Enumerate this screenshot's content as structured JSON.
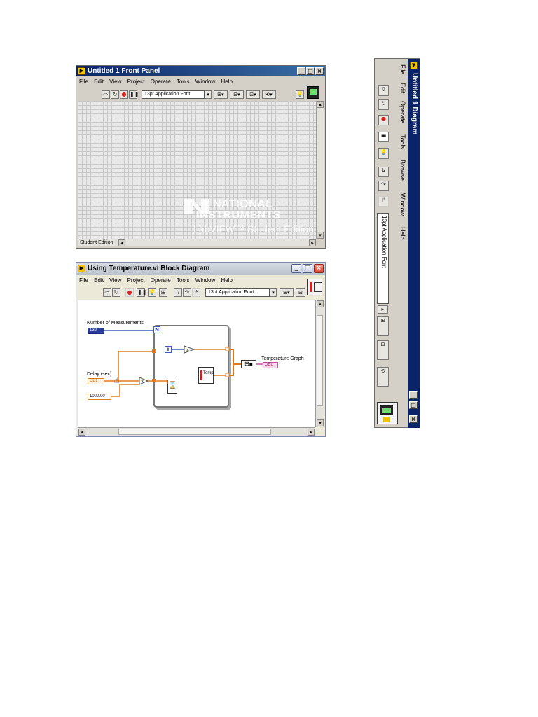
{
  "front_panel": {
    "title": "Untitled 1 Front Panel",
    "menu": [
      "File",
      "Edit",
      "View",
      "Project",
      "Operate",
      "Tools",
      "Window",
      "Help"
    ],
    "font_selector": "13pt Application Font",
    "watermark": {
      "line1": "NATIONAL",
      "line2": "INSTRUMENTS",
      "line3": "LabVIEW™ Student Edition"
    },
    "status_text": "Student Edition",
    "window_buttons": [
      "_",
      "□",
      "×"
    ]
  },
  "block_diagram": {
    "title": "Using Temperature.vi Block Diagram",
    "menu": [
      "File",
      "Edit",
      "View",
      "Project",
      "Operate",
      "Tools",
      "Window",
      "Help"
    ],
    "font_selector": "13pt Application Font",
    "labels": {
      "num_measurements": "Number of Measurements",
      "num_measurements_value": "132",
      "loop_count": "N",
      "iteration": "i",
      "delay": "Delay (sec)",
      "delay_value": "DBL",
      "constant": "1000.00",
      "temp_subvi": "Temp",
      "graph": "Temperature Graph",
      "graph_terminal": "DBL",
      "multiply": "×"
    },
    "window_buttons": [
      "_",
      "□",
      "×"
    ]
  },
  "vertical_diagram": {
    "title": "Untitled 1 Diagram",
    "menu": [
      "File",
      "Edit",
      "Operate",
      "Tools",
      "Browse",
      "Window",
      "Help"
    ],
    "font_selector": "13pt Application Font",
    "window_buttons": [
      "_",
      "□",
      "×"
    ]
  },
  "colors": {
    "title_blue": "#0a246a",
    "window_gray": "#d4d0c8",
    "wire_orange": "#e07b1c",
    "wire_blue": "#3a5bbf",
    "wire_pink": "#c64fa0",
    "subvi_blue": "#2b3c9c"
  }
}
